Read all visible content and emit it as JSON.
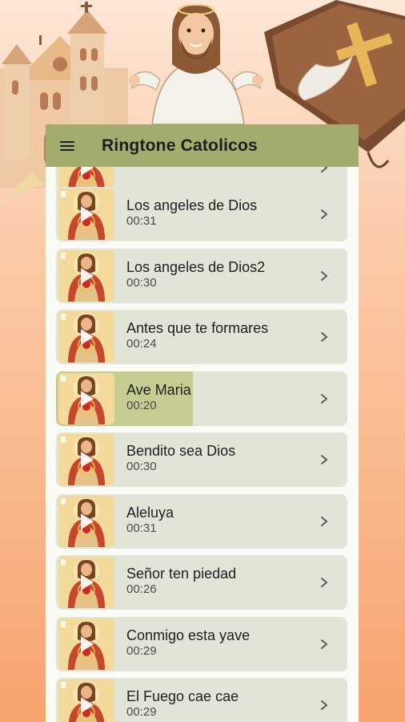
{
  "app": {
    "title": "Ringtone Catolicos"
  },
  "colors": {
    "appbar": "#a3ab6e",
    "card": "#e1e5d8",
    "progress": "#c7cc92"
  },
  "icons": {
    "menu": "menu-icon",
    "thumb": "sacred-heart-jesus-thumbnail",
    "play": "play-icon",
    "chevron": "chevron-right-icon"
  },
  "songs": [
    {
      "title": "",
      "duration": ""
    },
    {
      "title": "Los angeles de Dios",
      "duration": "00:31"
    },
    {
      "title": "Los angeles de Dios2",
      "duration": "00:30"
    },
    {
      "title": "Antes que te formares",
      "duration": "00:24"
    },
    {
      "title": "Ave Maria",
      "duration": "00:20",
      "playing": true,
      "progress": 0.47
    },
    {
      "title": "Bendito sea Dios",
      "duration": "00:30"
    },
    {
      "title": "Aleluya",
      "duration": "00:31"
    },
    {
      "title": "Señor ten piedad",
      "duration": "00:26"
    },
    {
      "title": "Conmigo esta yave",
      "duration": "00:29"
    },
    {
      "title": "El Fuego cae cae",
      "duration": "00:29"
    }
  ]
}
